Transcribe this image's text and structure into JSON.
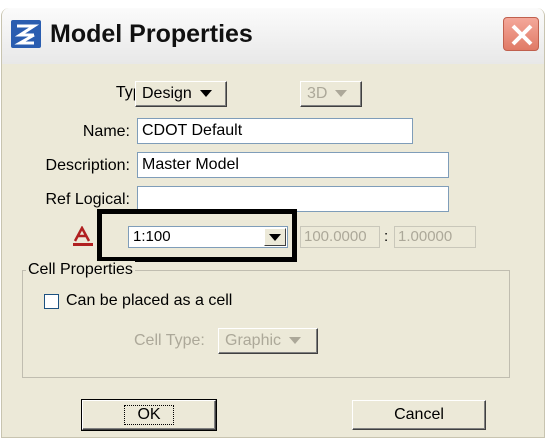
{
  "window": {
    "title": "Model Properties"
  },
  "type": {
    "label": "Type:",
    "value": "Design",
    "dim_value": "3D"
  },
  "name": {
    "label": "Name:",
    "value": "CDOT Default"
  },
  "description": {
    "label": "Description:",
    "value": "Master Model"
  },
  "ref_logical": {
    "label": "Ref Logical:",
    "value": ""
  },
  "annotation": {
    "icon": "annotation-scale-icon",
    "scale": "1:100",
    "scale_left": "100.0000",
    "separator": ":",
    "scale_right": "1.00000"
  },
  "cell_properties": {
    "title": "Cell Properties",
    "checkbox_label": "Can be placed as a cell",
    "checked": false,
    "cell_type_label": "Cell Type:",
    "cell_type_value": "Graphic"
  },
  "buttons": {
    "ok": "OK",
    "cancel": "Cancel"
  },
  "colors": {
    "highlight_box": "#000000",
    "dialog_bg": "#ece9d8",
    "close_button": "#e07a66"
  }
}
